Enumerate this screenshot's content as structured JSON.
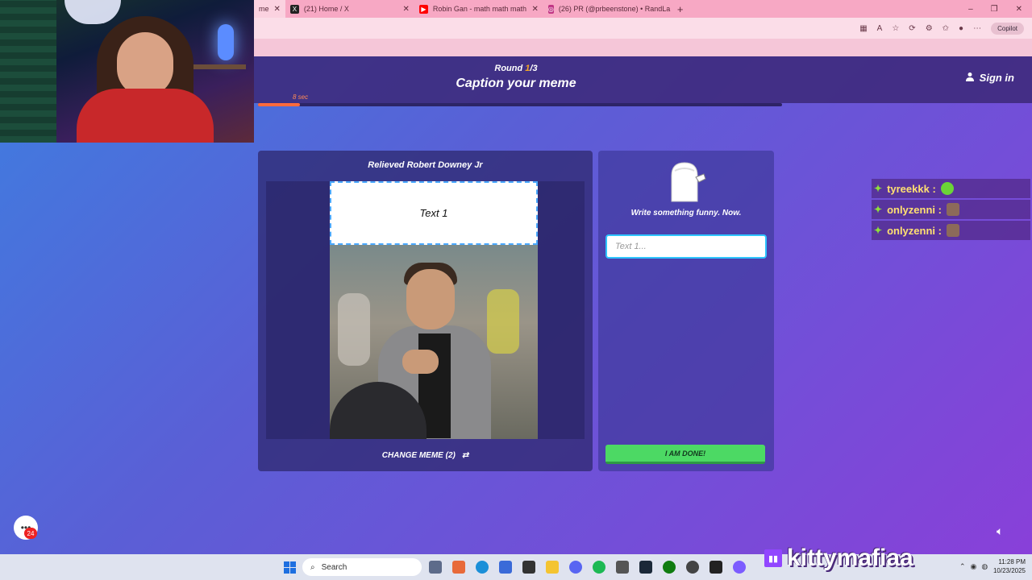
{
  "browser": {
    "tabs": [
      {
        "label": "me",
        "favicon": "",
        "favicon_color": "#f7a8c4",
        "active": true
      },
      {
        "label": "(21) Home / X",
        "favicon": "X",
        "favicon_color": "#222222",
        "active": false
      },
      {
        "label": "Robin Gan - math math math",
        "favicon": "▶",
        "favicon_color": "#ff0000",
        "active": false
      },
      {
        "label": "(26) PR (@prbeenstone) • RandLa",
        "favicon": "◎",
        "favicon_color": "#c13584",
        "active": false
      }
    ],
    "new_tab": "+",
    "copilot_label": "Copilot"
  },
  "game": {
    "round_prefix": "Round ",
    "round_current": "1",
    "round_total": "/3",
    "title": "Caption your meme",
    "sign_in": "Sign in",
    "timer_label": "8 sec",
    "timer_progress": 0.08,
    "meme_name": "Relieved Robert Downey Jr",
    "caption_text": "Text 1",
    "change_meme_label": "CHANGE MEME (2)",
    "prompt": "Write something funny. Now.",
    "input_placeholder": "Text 1...",
    "done_label": "I AM DONE!"
  },
  "chat": [
    {
      "user": "tyreekkk :",
      "emote": "green-emote"
    },
    {
      "user": "onlyzenni :",
      "emote": "cat-emote"
    },
    {
      "user": "onlyzenni :",
      "emote": "cat-emote"
    }
  ],
  "overlay": {
    "notification_count": "24",
    "channel_name": "kittymafiaa"
  },
  "taskbar": {
    "search_label": "Search",
    "time": "11:28 PM",
    "date": "10/23/2025"
  },
  "colors": {
    "accent_orange": "#f5a623",
    "done_green": "#4cd964",
    "input_border": "#2ec4ff",
    "chat_name": "#ffe071",
    "twitch_purple": "#9146ff"
  }
}
